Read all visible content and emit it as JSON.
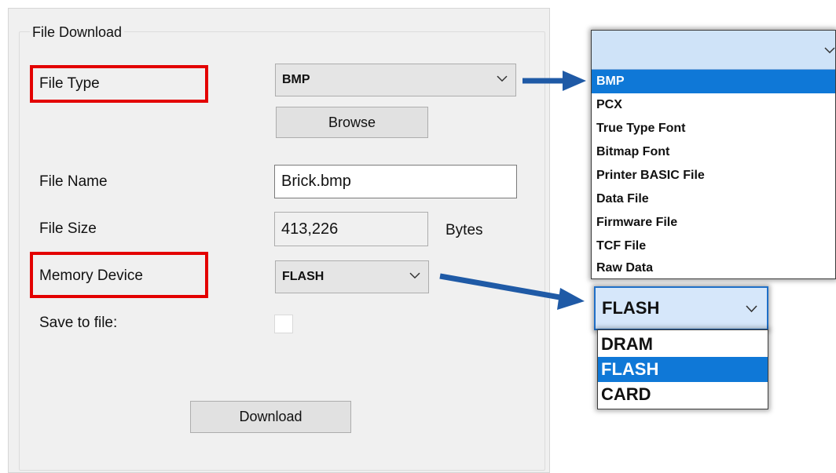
{
  "group": {
    "title": "File Download"
  },
  "labels": {
    "file_type": "File Type",
    "file_name": "File Name",
    "file_size": "File Size",
    "memory_device": "Memory Device",
    "save_to_file": "Save to file:",
    "bytes": "Bytes"
  },
  "file_type_select": {
    "value": "BMP"
  },
  "memory_device_select": {
    "value": "FLASH"
  },
  "file_name_input": {
    "value": "Brick.bmp"
  },
  "file_size_input": {
    "value": "413,226"
  },
  "save_to_file": {
    "checked": false
  },
  "buttons": {
    "browse": "Browse",
    "download": "Download"
  },
  "file_type_dropdown": {
    "selected": "BMP",
    "options": [
      "BMP",
      "PCX",
      "True Type Font",
      "Bitmap Font",
      "Printer BASIC File",
      "Data File",
      "Firmware File",
      "TCF File",
      "Raw Data"
    ]
  },
  "memory_device_dropdown": {
    "value": "FLASH",
    "selected": "FLASH",
    "options": [
      "DRAM",
      "FLASH",
      "CARD"
    ]
  },
  "colors": {
    "highlight_box": "#e30000",
    "arrow": "#1f5aa6",
    "selection": "#0f78d7"
  },
  "icons": {
    "dropdown": "chevron-down-icon",
    "callout": "arrow-right-icon"
  }
}
